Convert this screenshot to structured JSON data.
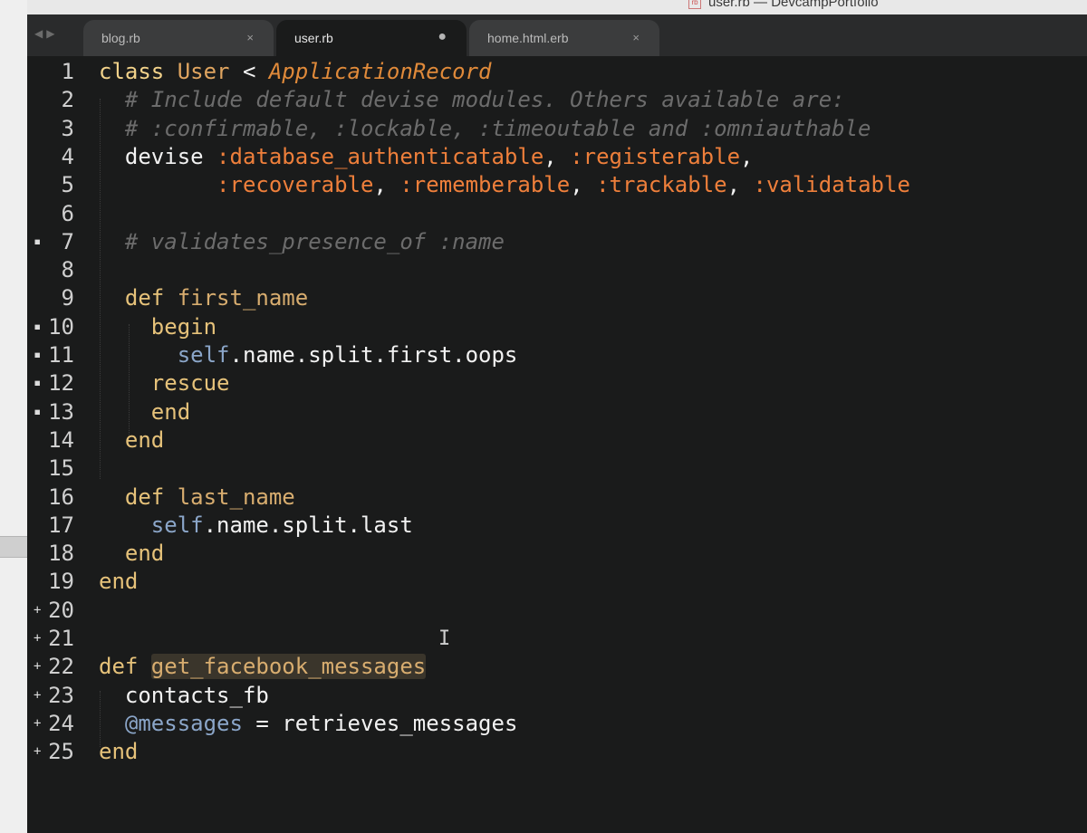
{
  "window": {
    "title": "user.rb — DevcampPortfolio",
    "file_badge": "rb"
  },
  "tabs": [
    {
      "label": "blog.rb",
      "state": "close"
    },
    {
      "label": "user.rb",
      "state": "modified",
      "active": true
    },
    {
      "label": "home.html.erb",
      "state": "close"
    }
  ],
  "icons": {
    "close": "×",
    "modified": "●",
    "nav_back": "◀",
    "nav_forward": "▶",
    "cursor": "I-beam-cursor-icon"
  },
  "colors": {
    "keyword": "#f2d28a",
    "keyword_def": "#e6c27a",
    "const": "#e0a560",
    "const_italic": "#e08a3a",
    "comment": "#6c6c6c",
    "symbol": "#ee7f3b",
    "self": "#8ba6c9",
    "ivar": "#8ba6c9",
    "method_name": "#d8ad6f",
    "plain": "#f2f2f2",
    "highlight_bg": "#3a352b"
  },
  "lines": [
    {
      "num": "1",
      "marker": "",
      "segments": [
        {
          "t": "class ",
          "c": "keyword"
        },
        {
          "t": "User",
          "c": "const"
        },
        {
          "t": " < ",
          "c": "plain"
        },
        {
          "t": "ApplicationRecord",
          "c": "const_italic",
          "i": true
        }
      ]
    },
    {
      "num": "2",
      "marker": "",
      "segments": [
        {
          "t": "  # Include default devise modules. Others available are:",
          "c": "comment",
          "i": true
        }
      ]
    },
    {
      "num": "3",
      "marker": "",
      "segments": [
        {
          "t": "  # :confirmable, :lockable, :timeoutable and :omniauthable",
          "c": "comment",
          "i": true
        }
      ]
    },
    {
      "num": "4",
      "marker": "",
      "segments": [
        {
          "t": "  devise ",
          "c": "plain"
        },
        {
          "t": ":database_authenticatable",
          "c": "symbol"
        },
        {
          "t": ", ",
          "c": "plain"
        },
        {
          "t": ":registerable",
          "c": "symbol"
        },
        {
          "t": ",",
          "c": "plain"
        }
      ]
    },
    {
      "num": "5",
      "marker": "",
      "segments": [
        {
          "t": "         ",
          "c": "plain"
        },
        {
          "t": ":recoverable",
          "c": "symbol"
        },
        {
          "t": ", ",
          "c": "plain"
        },
        {
          "t": ":rememberable",
          "c": "symbol"
        },
        {
          "t": ", ",
          "c": "plain"
        },
        {
          "t": ":trackable",
          "c": "symbol"
        },
        {
          "t": ", ",
          "c": "plain"
        },
        {
          "t": ":validatable",
          "c": "symbol"
        }
      ]
    },
    {
      "num": "6",
      "marker": "",
      "segments": []
    },
    {
      "num": "7",
      "marker": "▪",
      "segments": [
        {
          "t": "  # validates_presence_of :name",
          "c": "comment",
          "i": true
        }
      ]
    },
    {
      "num": "8",
      "marker": "",
      "segments": []
    },
    {
      "num": "9",
      "marker": "",
      "segments": [
        {
          "t": "  def ",
          "c": "keyword_def"
        },
        {
          "t": "first_name",
          "c": "method_name"
        }
      ]
    },
    {
      "num": "10",
      "marker": "▪",
      "segments": [
        {
          "t": "    begin",
          "c": "keyword_def"
        }
      ]
    },
    {
      "num": "11",
      "marker": "▪",
      "segments": [
        {
          "t": "      ",
          "c": "plain"
        },
        {
          "t": "self",
          "c": "self"
        },
        {
          "t": ".name.split.first.oops",
          "c": "plain"
        }
      ]
    },
    {
      "num": "12",
      "marker": "▪",
      "segments": [
        {
          "t": "    rescue",
          "c": "keyword_def"
        }
      ]
    },
    {
      "num": "13",
      "marker": "▪",
      "segments": [
        {
          "t": "    end",
          "c": "keyword_def"
        }
      ]
    },
    {
      "num": "14",
      "marker": "",
      "segments": [
        {
          "t": "  end",
          "c": "keyword_def"
        }
      ]
    },
    {
      "num": "15",
      "marker": "",
      "segments": []
    },
    {
      "num": "16",
      "marker": "",
      "segments": [
        {
          "t": "  def ",
          "c": "keyword_def"
        },
        {
          "t": "last_name",
          "c": "method_name"
        }
      ]
    },
    {
      "num": "17",
      "marker": "",
      "segments": [
        {
          "t": "    ",
          "c": "plain"
        },
        {
          "t": "self",
          "c": "self"
        },
        {
          "t": ".name.split.last",
          "c": "plain"
        }
      ]
    },
    {
      "num": "18",
      "marker": "",
      "segments": [
        {
          "t": "  end",
          "c": "keyword_def"
        }
      ]
    },
    {
      "num": "19",
      "marker": "",
      "segments": [
        {
          "t": "end",
          "c": "keyword_def"
        }
      ]
    },
    {
      "num": "20",
      "marker": "+",
      "segments": []
    },
    {
      "num": "21",
      "marker": "+",
      "segments": []
    },
    {
      "num": "22",
      "marker": "+",
      "segments": [
        {
          "t": "def ",
          "c": "keyword_def"
        },
        {
          "t": "get_facebook_messages",
          "c": "method_name",
          "hl": true
        }
      ]
    },
    {
      "num": "23",
      "marker": "+",
      "segments": [
        {
          "t": "  contacts_fb",
          "c": "plain"
        }
      ]
    },
    {
      "num": "24",
      "marker": "+",
      "segments": [
        {
          "t": "  ",
          "c": "plain"
        },
        {
          "t": "@messages",
          "c": "ivar"
        },
        {
          "t": " = retrieves_messages",
          "c": "plain"
        }
      ]
    },
    {
      "num": "25",
      "marker": "+",
      "segments": [
        {
          "t": "end",
          "c": "keyword_def"
        }
      ]
    }
  ]
}
